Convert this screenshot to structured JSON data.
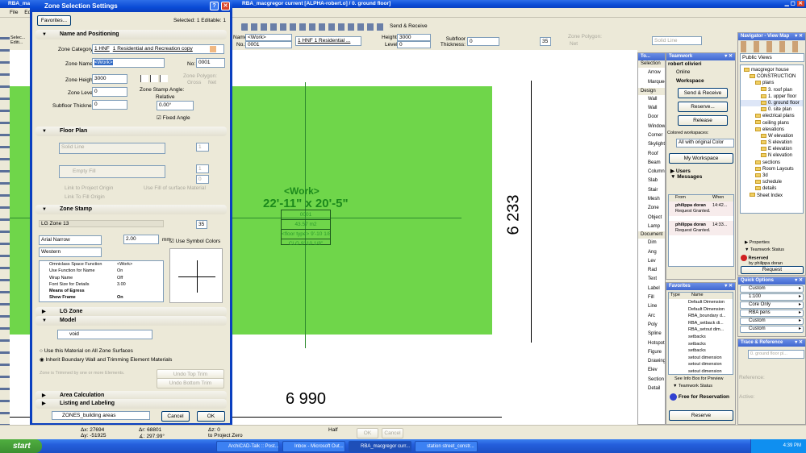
{
  "app": {
    "title": "RBA_macgregor current [ALPHA-robert.o] / 0. ground floor]",
    "title_left": "RBA_mac",
    "menu": [
      "File",
      "Edit"
    ]
  },
  "toolbar": {
    "send_receive": "Send & Receive"
  },
  "infobox": {
    "selected": "Selec...",
    "editable": "Editi...",
    "name_label": "Name:",
    "name_value": "<Work>",
    "no_label": "No.:",
    "no_value": "0001",
    "category": "1 HNF  1 Residential ...",
    "height_label": "Height:",
    "height_value": "3000",
    "level_label": "Level:",
    "level_value": "0",
    "subfloor_label": "Subfloor Thickness:",
    "subfloor_value": "0",
    "pen_value": "35",
    "polygon_label": "Zone Polygon:",
    "polygon_value": "Net",
    "line_type": "Solid Line"
  },
  "dialog": {
    "title": "Zone Selection Settings",
    "favorites": "Favorites...",
    "selected_info": "Selected: 1 Editable: 1",
    "name_positioning": {
      "heading": "Name and Positioning",
      "category_label": "Zone Category:",
      "category_code": "1 HNF",
      "category_name": "1 Residential and Recreation copy",
      "name_label": "Zone Name:",
      "name_value": "<Work>",
      "no_label": "No:",
      "no_value": "0001",
      "height_label": "Zone Height:",
      "height_value": "3000",
      "level_label": "Zone Level:",
      "level_value": "0",
      "subfloor_label": "Subfloor Thickness:",
      "subfloor_value": "0",
      "polygon_label": "Zone Polygon:",
      "gross": "Gross",
      "net": "Net",
      "stamp_angle_label": "Zone Stamp Angle:",
      "relative": "Relative",
      "angle_value": "0.00°",
      "fixed_angle": "Fixed Angle"
    },
    "floor_plan": {
      "heading": "Floor Plan",
      "line_type": "Solid Line",
      "fill": "Empty Fill",
      "pen1": "1",
      "pen2": "1",
      "pen3": "0",
      "link_project": "Link to Project Origin",
      "link_fill": "Link To Fill Origin",
      "use_surface": "Use Fill of surface Material"
    },
    "zone_stamp": {
      "heading": "Zone Stamp",
      "stamp_name": "LG Zone 13",
      "pen": "35",
      "font": "Arial Narrow",
      "size": "2.00",
      "unit": "mm",
      "script": "Western",
      "use_symbol_colors": "Use Symbol Colors",
      "params": [
        {
          "name": "Omniclass Space Function",
          "value": "<Work>"
        },
        {
          "name": "Use Function for Name",
          "value": "On"
        },
        {
          "name": "Wrap Name",
          "value": "Off"
        },
        {
          "name": "Font Size for Details",
          "value": "3.00"
        },
        {
          "name": "Means of Egress",
          "value": ""
        },
        {
          "name": "Show Frame",
          "value": "On"
        }
      ]
    },
    "lg_zone": {
      "heading": "LG Zone"
    },
    "model": {
      "heading": "Model",
      "material": "void",
      "opt1": "Use this Material on All Zone Surfaces",
      "opt2": "Inherit Boundary Wall and Trimming Element Materials",
      "trim_note": "Zone is Trimmed by one or more Elements.",
      "undo_top": "Undo Top Trim",
      "undo_bottom": "Undo Bottom Trim"
    },
    "area_calc": {
      "heading": "Area Calculation"
    },
    "listing": {
      "heading": "Listing and Labeling"
    },
    "layer": "ZONES_building areas",
    "cancel": "Cancel",
    "ok": "OK"
  },
  "canvas": {
    "zone_name": "<Work>",
    "zone_dims": "22'-11\" x 20'-5\"",
    "zone_no": "0001",
    "zone_area": "43.57 m2",
    "floor_type": "<floor type>  9'-10 1/8\"",
    "clg": "CLG  9'-10 1/8\"",
    "dim_vertical": "6 233",
    "dim_horizontal": "6 990",
    "zone_color": "#6fd64a"
  },
  "toolbox": {
    "title": "To...",
    "selection": "Selection",
    "design": "Design",
    "document": "Document",
    "tools": [
      "Arrow",
      "Marquee"
    ],
    "design_tools": [
      "Wall",
      "Wall",
      "Door",
      "Window",
      "Corner",
      "Skylight",
      "Roof",
      "Beam",
      "Column",
      "Slab",
      "Stair",
      "Mesh",
      "Zone",
      "Object",
      "Lamp"
    ],
    "doc_tools": [
      "Dim",
      "Ang",
      "Lev",
      "Rad",
      "Text",
      "Label",
      "Fill",
      "Line",
      "Arc",
      "Poly",
      "Spline",
      "Hotspot",
      "Figure",
      "Drawing",
      "Elev",
      "Section",
      "Detail"
    ]
  },
  "teamwork": {
    "title": "Teamwork",
    "user": "robert olivieri",
    "status": "Online",
    "workspace": "Workspace",
    "send_receive": "Send & Receive",
    "reserve": "Reserve...",
    "release": "Release",
    "colored_label": "Colored workspaces:",
    "colored_value": "All with original Color",
    "my_workspace": "My Workspace",
    "users": "Users",
    "messages": "Messages",
    "col_from": "From",
    "col_when": "When",
    "msgs": [
      {
        "from": "philippa doran",
        "when": "14:42...",
        "text": "Request Granted."
      },
      {
        "from": "philippa doran",
        "when": "14:33...",
        "text": "Request Granted."
      }
    ]
  },
  "favorites": {
    "title": "Favorites",
    "col_type": "Type",
    "col_name": "Name",
    "items": [
      "Default Dimension",
      "Default Dimension",
      "RBA_boundary d...",
      "RBA_setback di...",
      "RBA_setout dim...",
      "setbacks",
      "setbacks",
      "setbacks",
      "setout dimension",
      "setout dimension",
      "setout dimension"
    ],
    "preview": "See Info Box for Preview",
    "tw_status": "Teamwork Status",
    "free": "Free for Reservation",
    "reserve": "Reserve"
  },
  "navigator": {
    "title": "Navigator - View Map",
    "public_views": "Public Views",
    "tree": [
      {
        "t": "macgregor house",
        "d": 0
      },
      {
        "t": "CONSTRUCTION",
        "d": 1
      },
      {
        "t": "plans",
        "d": 2
      },
      {
        "t": "3. roof plan",
        "d": 3
      },
      {
        "t": "1. upper floor",
        "d": 3
      },
      {
        "t": "0. ground floor",
        "d": 3
      },
      {
        "t": "0. site plan",
        "d": 3
      },
      {
        "t": "electrical plans",
        "d": 2
      },
      {
        "t": "ceiling plans",
        "d": 2
      },
      {
        "t": "elevations",
        "d": 2
      },
      {
        "t": "W elevation",
        "d": 3
      },
      {
        "t": "S elevation",
        "d": 3
      },
      {
        "t": "E elevation",
        "d": 3
      },
      {
        "t": "N elevation",
        "d": 3
      },
      {
        "t": "sections",
        "d": 2
      },
      {
        "t": "Room Layouts",
        "d": 2
      },
      {
        "t": "3d",
        "d": 2
      },
      {
        "t": "schedule",
        "d": 2
      },
      {
        "t": "details",
        "d": 2
      },
      {
        "t": "Sheet Index",
        "d": 1
      }
    ],
    "properties": "Properties",
    "tw_status": "Teamwork Status",
    "reserved": "Reserved",
    "reserved_by": "by philippa doran",
    "request": "Request"
  },
  "quick_options": {
    "title": "Quick Options",
    "items": [
      "Custom",
      "1:100",
      "Core Only",
      "RBA pens",
      "Custom",
      "Custom"
    ]
  },
  "trace": {
    "title": "Trace & Reference",
    "source": "0. ground floor pl...",
    "reference": "Reference:",
    "active": "Active:"
  },
  "status": {
    "ax": "Δx: 27694",
    "ay": "Δy: -51925",
    "ar": "Δr: 68801",
    "aa": "∡: 297.99°",
    "az": "Δz: 0",
    "zero": "to Project Zero",
    "half": "Half",
    "ok": "OK",
    "cancel": "Cancel"
  },
  "taskbar": {
    "start": "start",
    "items": [
      "ArchiCAD-Talk :: Post...",
      "Inbox - Microsoft Out...",
      "RBA_macgregor curr...",
      "station street_constr..."
    ],
    "clock": "4:39 PM"
  }
}
